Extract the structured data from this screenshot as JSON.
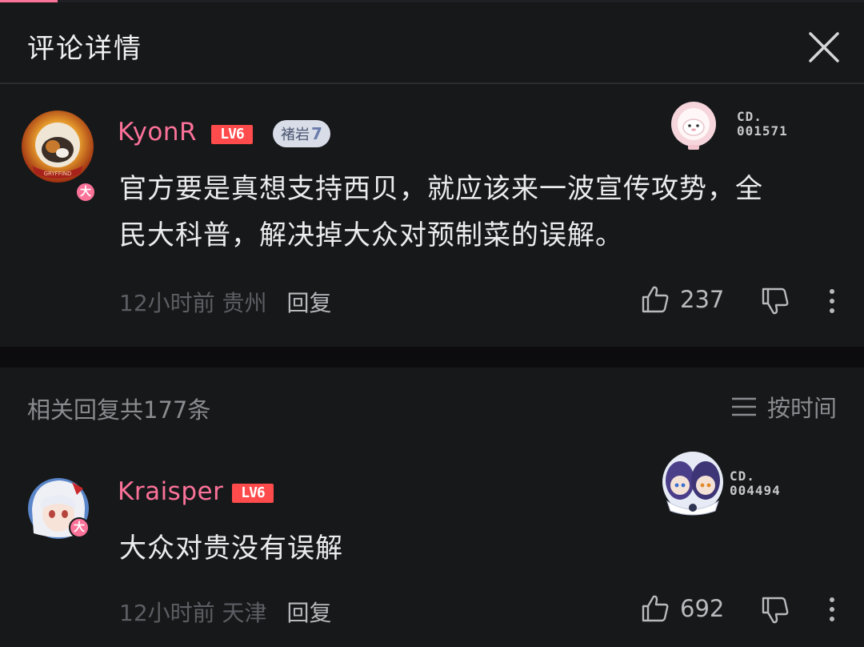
{
  "header": {
    "title": "评论详情",
    "close_icon": "close-icon"
  },
  "main_comment": {
    "username": "KyonR",
    "level": "LV6",
    "fan_badge": {
      "name": "褚岩",
      "level": "7"
    },
    "collection": {
      "line1": "CD.",
      "line2": "001571"
    },
    "content_line1": "官方要是真想支持西贝，就应该来一波宣传攻势，全",
    "content_line2": "民大科普，解决掉大众对预制菜的误解。",
    "time": "12小时前",
    "location": "贵州",
    "reply_label": "回复",
    "likes": "237"
  },
  "replies": {
    "count_label": "相关回复共177条",
    "sort_label": "按时间"
  },
  "reply_comment": {
    "username": "Kraisper",
    "level": "LV6",
    "collection": {
      "line1": "CD.",
      "line2": "004494"
    },
    "content": "大众对贵没有误解",
    "time": "12小时前",
    "location": "天津",
    "reply_label": "回复",
    "likes": "692"
  },
  "badges": {
    "big_member": "大"
  },
  "colors": {
    "background": "#17181a",
    "accent": "#fb7299",
    "level_badge": "#ff4b4b",
    "muted_text": "#5d5e63"
  }
}
